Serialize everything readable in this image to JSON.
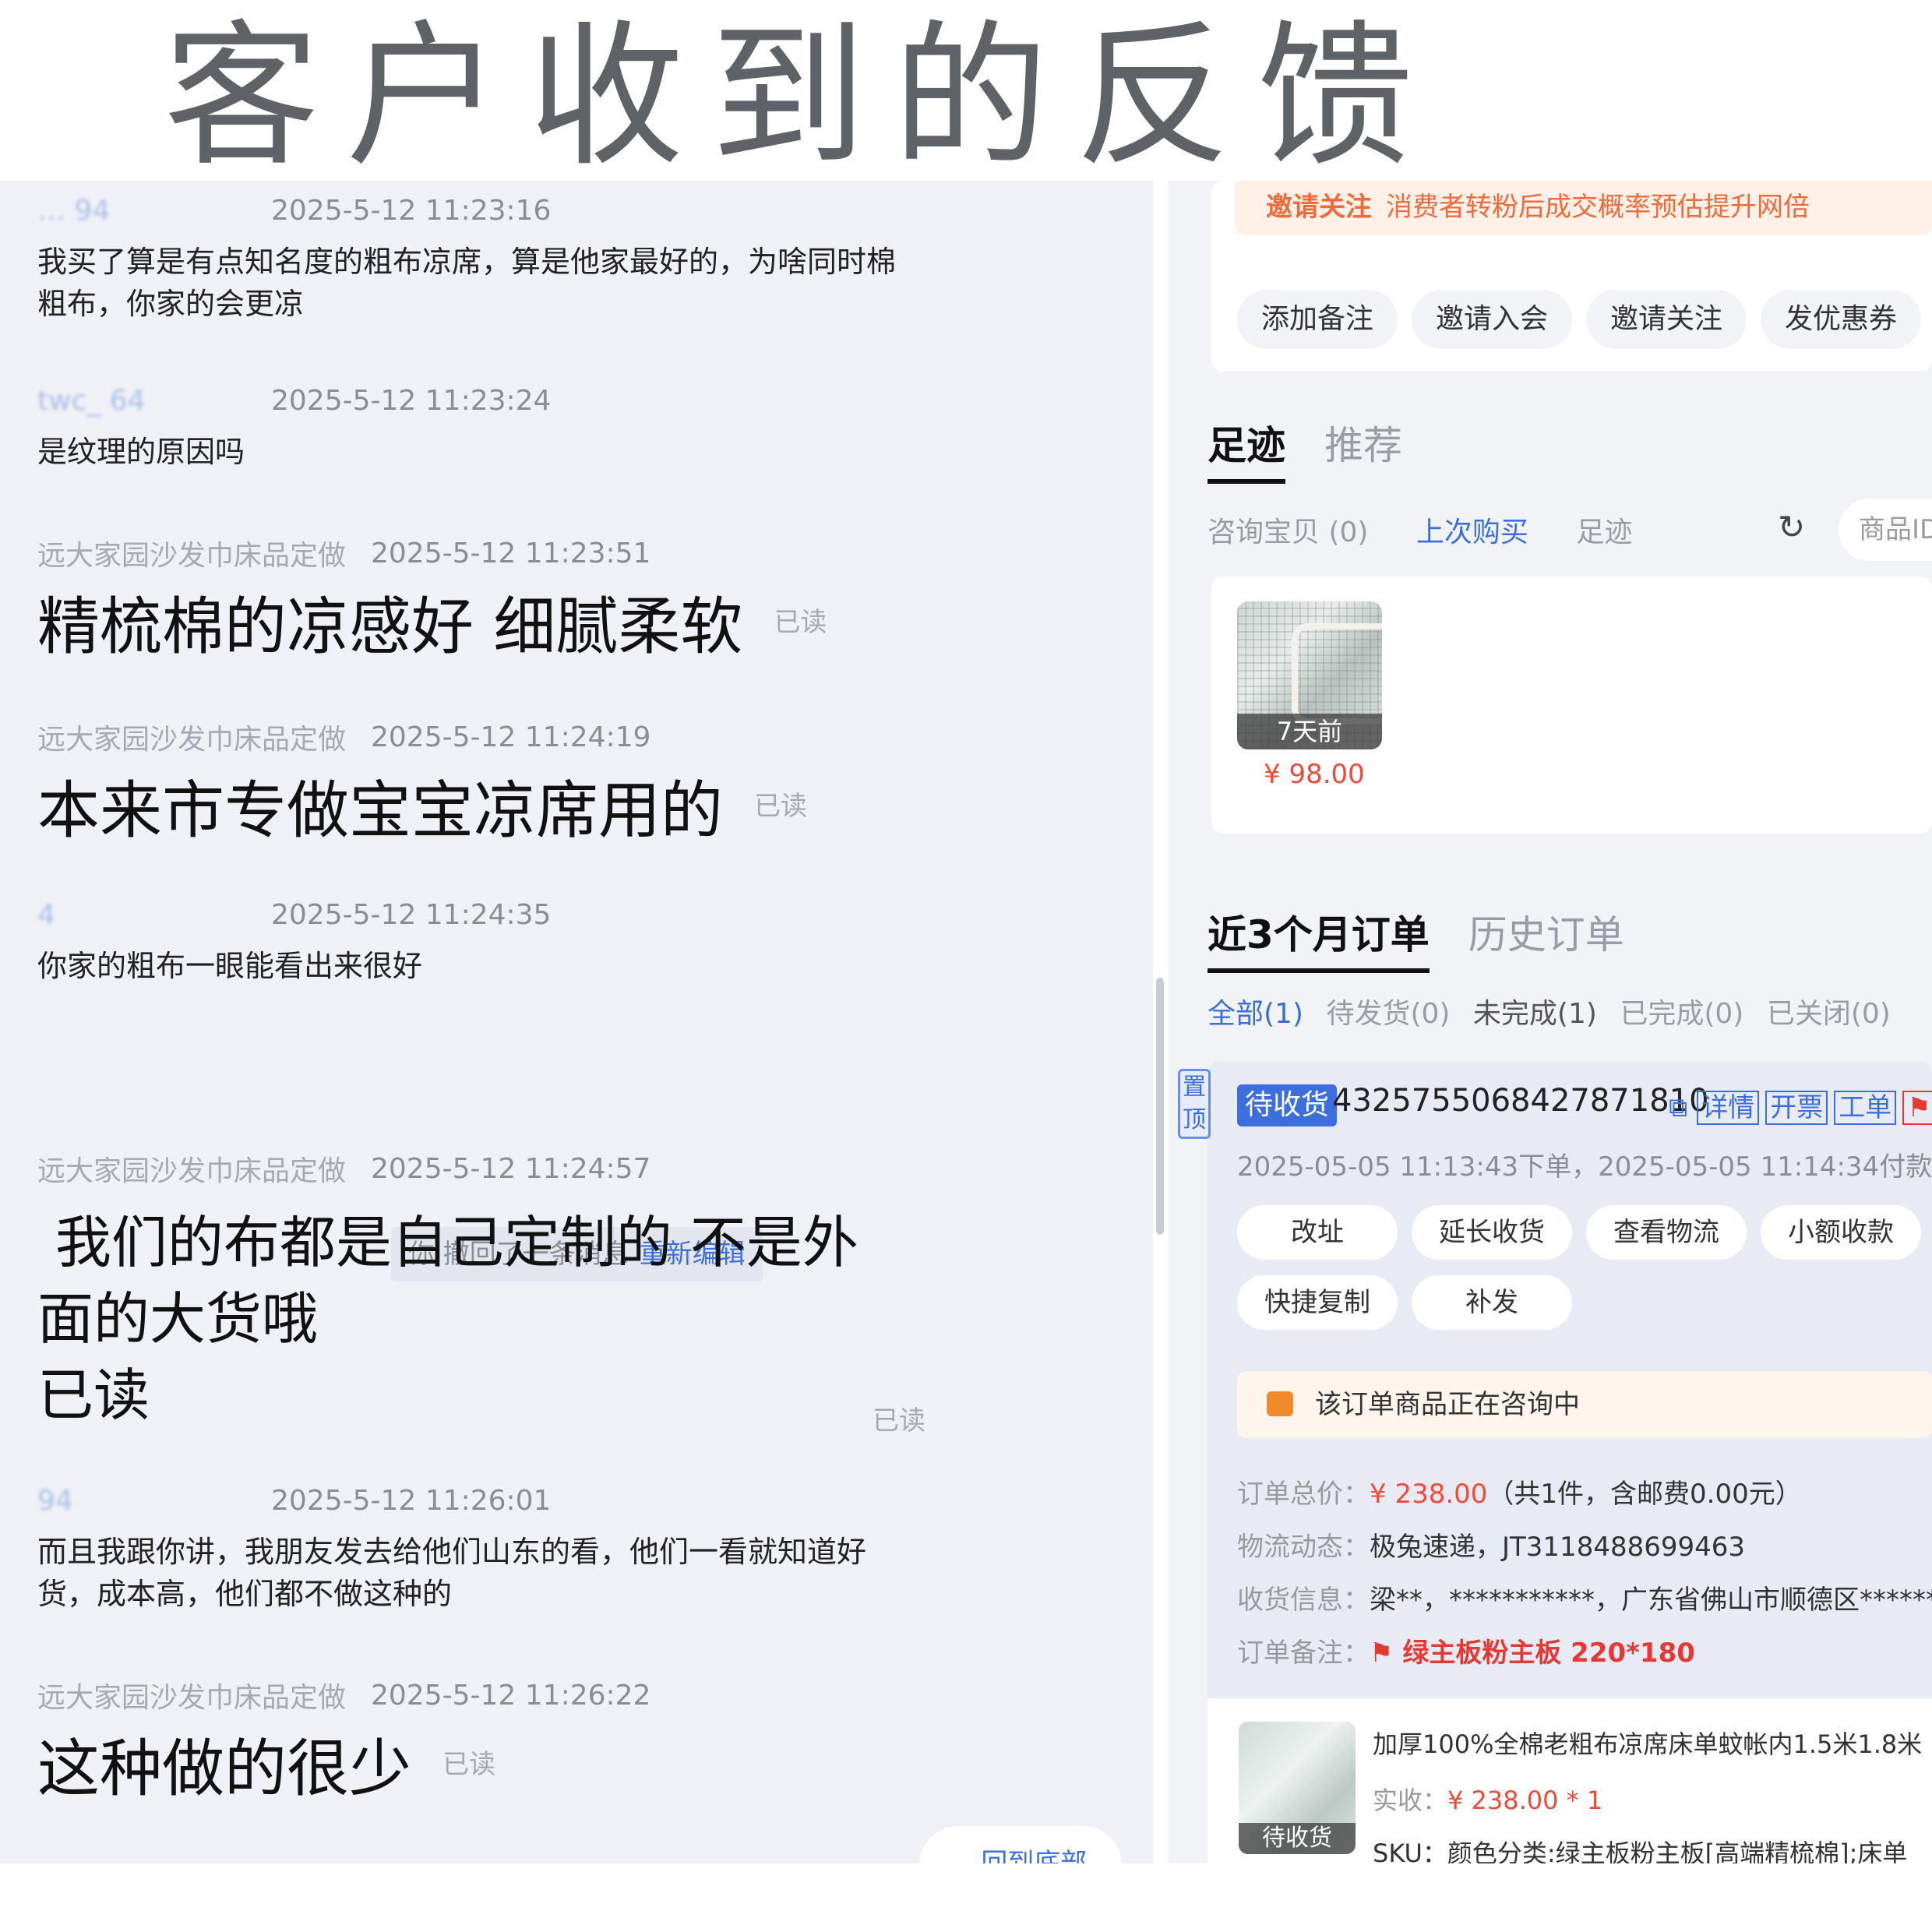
{
  "banner_title": "客户收到的反馈",
  "chat": {
    "messages": [
      {
        "sender": "… 94",
        "time": "2025-5-12 11:23:16",
        "text": "我买了算是有点知名度的粗布凉席，算是他家最好的，为啥同时棉粗布，你家的会更凉"
      },
      {
        "sender": "twc_ 64",
        "time": "2025-5-12 11:23:24",
        "text": "是纹理的原因吗"
      },
      {
        "sender": "远大家园沙发巾床品定做",
        "time": "2025-5-12 11:23:51",
        "text": "精梳棉的凉感好 细腻柔软",
        "status": "已读"
      },
      {
        "sender": "远大家园沙发巾床品定做",
        "time": "2025-5-12 11:24:19",
        "text": "本来市专做宝宝凉席用的",
        "status": "已读"
      },
      {
        "sender": "4",
        "time": "2025-5-12 11:24:35",
        "text": "你家的粗布一眼能看出来很好"
      },
      {
        "sender": "远大家园沙发巾床品定做",
        "time": "2025-5-12 11:24:57",
        "text_line1": " 我们的布都是自己定制的 不是外",
        "text_line2": "面的大货哦",
        "text_line3": "已读",
        "status": "已读"
      },
      {
        "sender": "94",
        "time": "2025-5-12 11:26:01",
        "text": "而且我跟你讲，我朋友发去给他们山东的看，他们一看就知道好货，成本高，他们都不做这种的"
      },
      {
        "sender": "远大家园沙发巾床品定做",
        "time": "2025-5-12 11:26:22",
        "text": "这种做的很少",
        "status": "已读"
      }
    ],
    "recall_notice": "你 撤回了一条消息",
    "recall_edit": "重新编辑",
    "scroll_bottom": "回到底部"
  },
  "right_panel": {
    "promo_strong": "邀请关注",
    "promo_text": "消费者转粉后成交概率预估提升网倍",
    "actions": [
      "添加备注",
      "邀请入会",
      "邀请关注",
      "发优惠券"
    ],
    "tabs": {
      "active": "足迹",
      "inactive": "推荐"
    },
    "subtabs": [
      "咨询宝贝 (0)",
      "上次购买",
      "足迹"
    ],
    "search_placeholder": "商品ID",
    "product": {
      "thumb_label": "7天前",
      "price": "¥ 98.00"
    },
    "order_tabs": {
      "active": "近3个月订单",
      "inactive": "历史订单"
    },
    "order_filters": [
      "全部(1)",
      "待发货(0)",
      "未完成(1)",
      "已完成(0)",
      "已关闭(0)"
    ],
    "order": {
      "pin": "置顶",
      "status": "待收货",
      "id": "4325755068427871810",
      "links": [
        "详情",
        "开票",
        "工单"
      ],
      "times": "2025-05-05 11:13:43下单，2025-05-05 11:14:34付款",
      "buttons": [
        "改址",
        "延长收货",
        "查看物流",
        "小额收款",
        "快捷复制",
        "补发"
      ],
      "notice": "该订单商品正在咨询中",
      "total_label": "订单总价：",
      "total_value": "¥ 238.00",
      "total_extra": "（共1件，含邮费0.00元）",
      "logistics_label": "物流动态：",
      "logistics_value": "极兔速递，JT3118488699463",
      "address_label": "收货信息：",
      "address_value": "梁**，***********，广东省佛山市顺德区********",
      "remark_label": "订单备注：",
      "remark_value": "绿主板粉主板  220*180",
      "item_title": "加厚100%全棉老粗布凉席床单蚊帐内1.5米1.8米",
      "item_paid_label": "实收：",
      "item_paid_value": "¥ 238.00 * 1",
      "item_sku": "SKU：颜色分类:绿主板粉主板[高端精梳棉];床单",
      "item_thumb_label": "待收货"
    }
  }
}
